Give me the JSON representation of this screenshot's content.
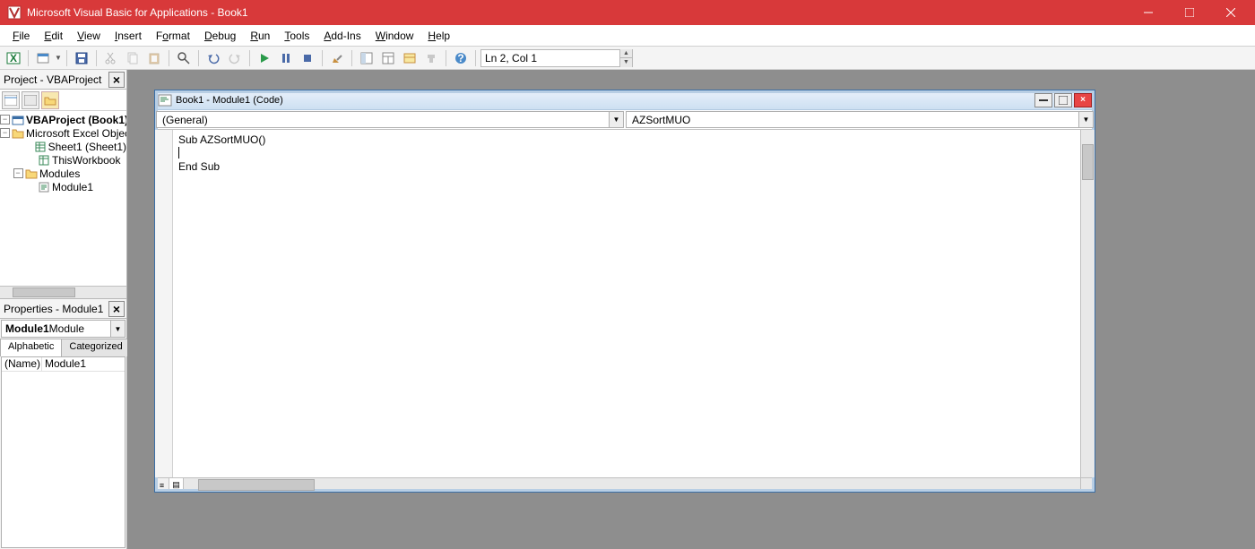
{
  "titlebar": {
    "title": "Microsoft Visual Basic for Applications - Book1"
  },
  "menu": {
    "file": "File",
    "edit": "Edit",
    "view": "View",
    "insert": "Insert",
    "format": "Format",
    "debug": "Debug",
    "run": "Run",
    "tools": "Tools",
    "addins": "Add-Ins",
    "window": "Window",
    "help": "Help"
  },
  "toolbar": {
    "position": "Ln 2, Col 1"
  },
  "project_panel": {
    "title": "Project - VBAProject",
    "root": "VBAProject (Book1)",
    "excel_objects": "Microsoft Excel Objects",
    "sheet1": "Sheet1 (Sheet1)",
    "thisworkbook": "ThisWorkbook",
    "modules": "Modules",
    "module1": "Module1"
  },
  "properties_panel": {
    "title": "Properties - Module1",
    "object": "Module1",
    "object_type": " Module",
    "tab_alpha": "Alphabetic",
    "tab_cat": "Categorized",
    "prop_name": "(Name)",
    "prop_name_val": "Module1"
  },
  "codewin": {
    "title": "Book1 - Module1 (Code)",
    "combo_left": "(General)",
    "combo_right": "AZSortMUO",
    "line1": "Sub AZSortMUO()",
    "line2": "",
    "line3": "End Sub"
  }
}
